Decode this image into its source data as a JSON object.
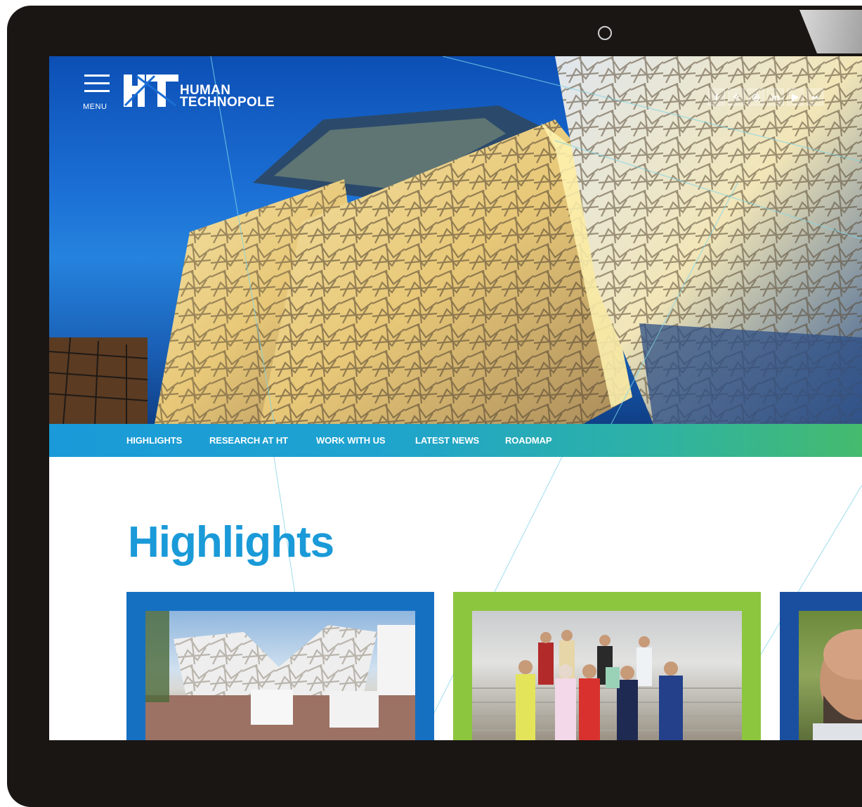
{
  "site": {
    "logo_line1": "HUMAN",
    "logo_line2": "TECHNOPOLE",
    "menu_label": "MENU"
  },
  "social": [
    {
      "icon": "facebook-icon",
      "glyph": "f"
    },
    {
      "icon": "twitter-icon",
      "glyph": "✧"
    },
    {
      "icon": "instagram-icon",
      "glyph": "◎"
    },
    {
      "icon": "linkedin-icon",
      "glyph": "in"
    },
    {
      "icon": "youtube-icon",
      "glyph": "▶"
    },
    {
      "icon": "flickr-icon",
      "glyph": "••"
    }
  ],
  "nav": {
    "items": [
      "HIGHLIGHTS",
      "RESEARCH AT HT",
      "WORK WITH US",
      "LATEST NEWS",
      "ROADMAP"
    ]
  },
  "main": {
    "section_title": "Highlights"
  },
  "colors": {
    "bezel": "#1a1614",
    "accent_blue": "#1a9ad8",
    "card_blue": "#1570c2",
    "card_green": "#8cc63f",
    "card_darkblue": "#1a4fa0"
  }
}
